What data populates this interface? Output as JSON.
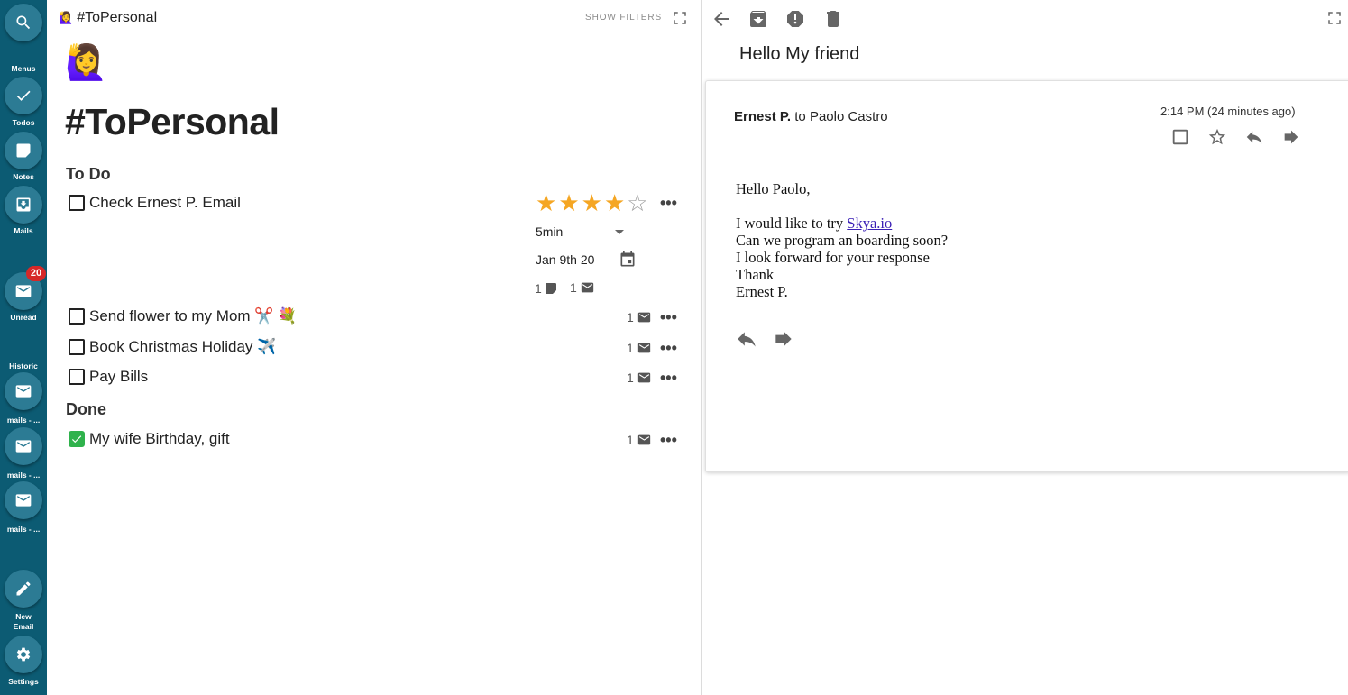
{
  "sidebar": {
    "menus_label": "Menus",
    "todos_label": "Todos",
    "notes_label": "Notes",
    "mails_label": "Mails",
    "unread_label": "Unread",
    "unread_count": "20",
    "historic_label": "Historic",
    "historic_items": [
      "mails - ...",
      "mails - ...",
      "mails - ..."
    ],
    "new_email_label_1": "New",
    "new_email_label_2": "Email",
    "settings_label": "Settings"
  },
  "list_pane": {
    "header_emoji": "🙋‍♀️",
    "header_title": "#ToPersonal",
    "show_filters": "SHOW FILTERS",
    "big_emoji": "🙋‍♀️",
    "page_title": "#ToPersonal",
    "todo_section": "To Do",
    "done_section": "Done",
    "todo_tasks": [
      {
        "text": "Check Ernest P. Email",
        "mail_count": "1",
        "note_count": "1",
        "rating": 4,
        "rating_max": 5,
        "duration": "5min",
        "date": "Jan 9th 20"
      },
      {
        "text": "Send flower to my Mom ✂️ 💐",
        "mail_count": "1"
      },
      {
        "text": "Book Christmas Holiday ✈️",
        "mail_count": "1"
      },
      {
        "text": "Pay Bills",
        "mail_count": "1"
      }
    ],
    "done_tasks": [
      {
        "text": "My wife Birthday, gift",
        "mail_count": "1"
      }
    ],
    "more_label": "•••"
  },
  "mail_pane": {
    "subject": "Hello My friend",
    "sender": "Ernest P.",
    "recipient_text": "to Paolo Castro",
    "time": "2:14 PM (24 minutes ago)",
    "body": {
      "greeting": "Hello Paolo,",
      "line1_prefix": "I would like to try ",
      "link_text": "Skya.io",
      "line2": "Can we program an boarding soon?",
      "line3": "I look forward for your response",
      "line4": "Thank",
      "signature": "Ernest P."
    }
  },
  "colors": {
    "sidebar_bg": "#0c5b73",
    "sidebar_button": "#2c7b94",
    "badge": "#d62828",
    "star": "#f5a623",
    "done_check": "#2fb24c",
    "link": "#3a1fb5"
  },
  "icons": {
    "sidebar": [
      "search-icon",
      "check-icon",
      "note-icon",
      "inbox-icon",
      "mail-icon",
      "pencil-icon",
      "gear-icon"
    ],
    "toolbar": [
      "back-arrow-icon",
      "archive-icon",
      "report-spam-icon",
      "trash-icon",
      "fullscreen-icon"
    ],
    "mail": [
      "checkbox-icon",
      "star-icon",
      "reply-icon",
      "forward-icon"
    ]
  }
}
